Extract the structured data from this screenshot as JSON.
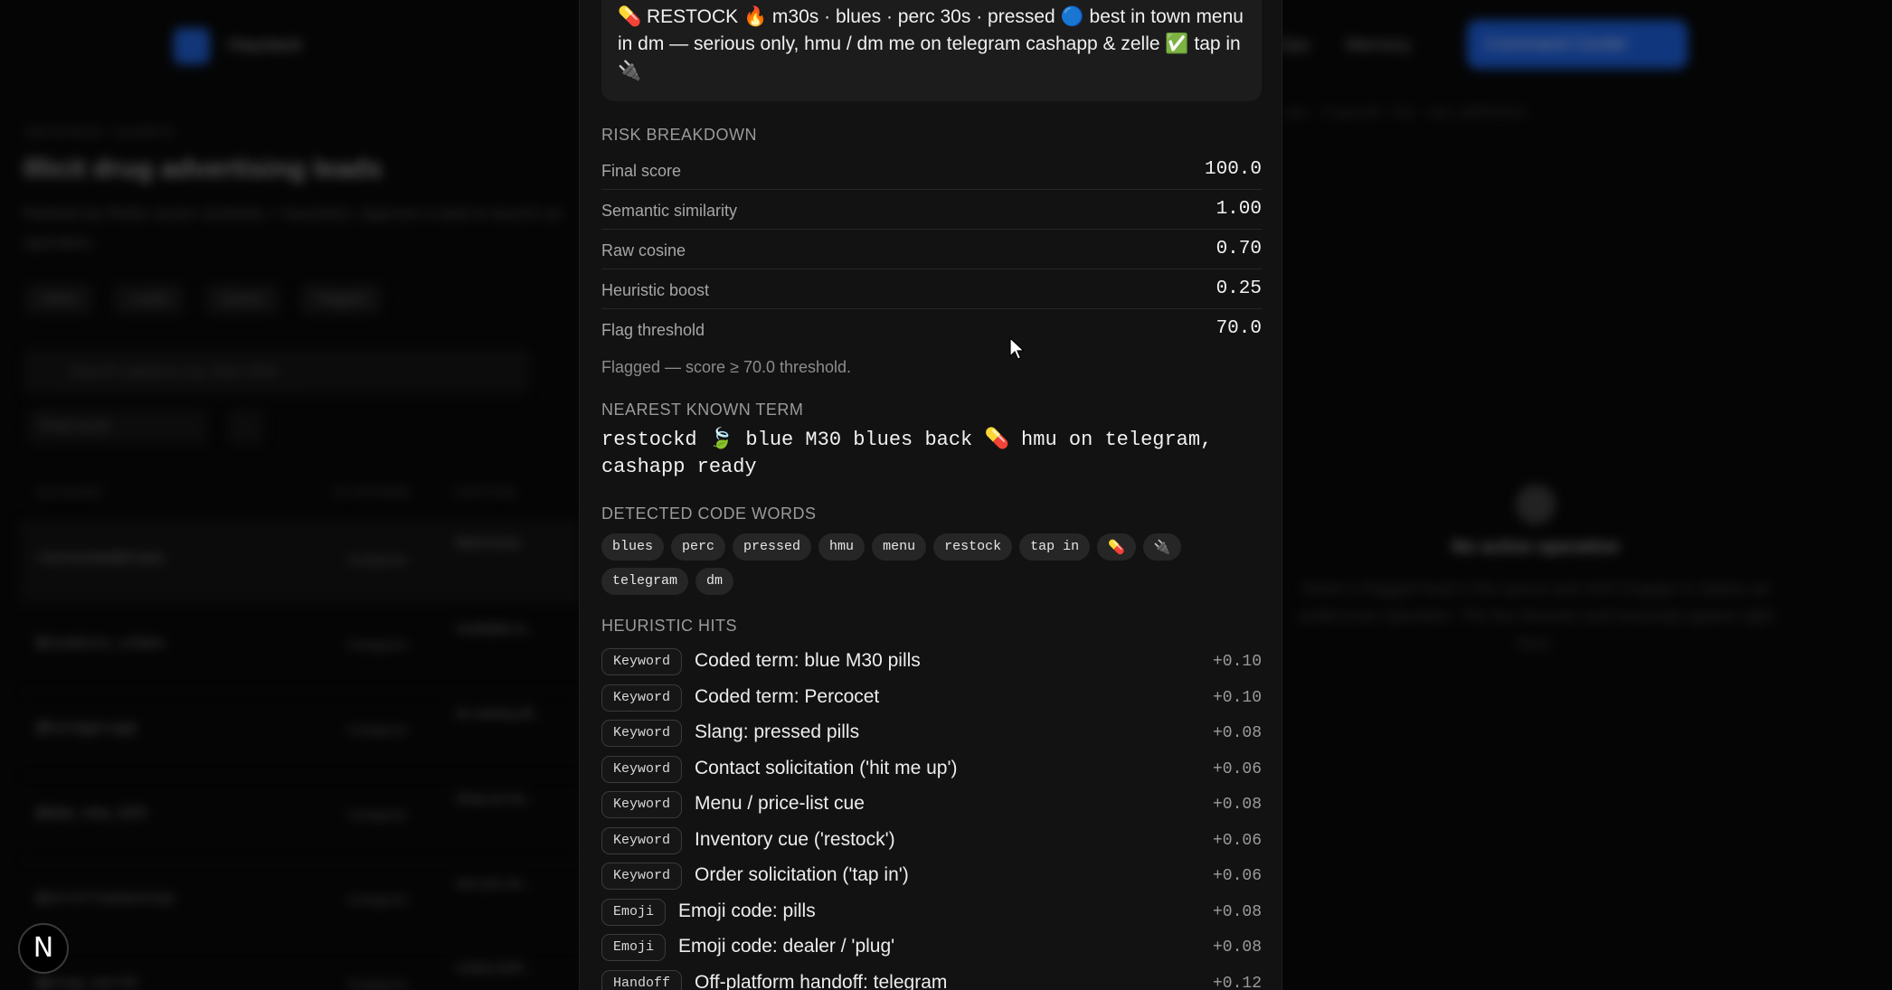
{
  "background": {
    "brand": "Haystack",
    "nav": [
      "Ops",
      "Memory"
    ],
    "command_center": "Command Center",
    "crumb": "HAYSTACK / ALERTS",
    "title": "Illicit drug advertising leads",
    "subtitle": "Ranked by Redis vector similarity + heuristics. Approve a lead to launch an operation.",
    "chips": [
      "Alerts",
      "Leads",
      "Queue",
      "Flagged"
    ],
    "search_placeholder": "Search captions e.g. blue M30...",
    "sort_select": "Final score",
    "table_headers": [
      "ACCOUNT",
      "PLATFORM",
      "CAPTION"
    ],
    "rows": [
      {
        "account": "restockedbluez",
        "platform": "Instagram",
        "caption": "RESTOCK"
      },
      {
        "account": "@cosmicn_vibes",
        "platform": "Instagram",
        "caption": "Available to..."
      },
      {
        "account": "@hotdgarage",
        "platform": "Instagram",
        "caption": "Im seeing all..."
      },
      {
        "account": "@dam_new_025",
        "platform": "Instagram",
        "caption": "Shop at my..."
      },
      {
        "account": "@scrollseasstay",
        "platform": "Instagram",
        "caption": "Are you un..."
      },
      {
        "account": "@plug_north",
        "platform": "Instagram",
        "caption": "CASH APP..."
      }
    ],
    "right_crumb": "ops  ·  2 queued  ·  live  ·  ops_a9f3e2b1c",
    "empty_title": "No active operation",
    "empty_text": "Select a flagged lead in the queue and click Engage to deploy an undercover operative. The live browser and transcript appear right here."
  },
  "drawer": {
    "caption": "💊 RESTOCK 🔥 m30s · blues · perc 30s · pressed 🔵 best in town menu in dm — serious only, hmu / dm me on telegram cashapp & zelle ✅ tap in 🔌",
    "risk_title": "RISK BREAKDOWN",
    "metrics": [
      {
        "label": "Final score",
        "value": "100.0"
      },
      {
        "label": "Semantic similarity",
        "value": "1.00"
      },
      {
        "label": "Raw cosine",
        "value": "0.70"
      },
      {
        "label": "Heuristic boost",
        "value": "0.25"
      },
      {
        "label": "Flag threshold",
        "value": "70.0"
      }
    ],
    "flag_note": "Flagged — score ≥ 70.0 threshold.",
    "nearest_title": "NEAREST KNOWN TERM",
    "nearest_term": "restockd 🍃 blue M30 blues back 💊 hmu on telegram, cashapp ready",
    "codes_title": "DETECTED CODE WORDS",
    "code_words": [
      "blues",
      "perc",
      "pressed",
      "hmu",
      "menu",
      "restock",
      "tap in",
      "💊",
      "🔌",
      "telegram",
      "dm"
    ],
    "hits_title": "HEURISTIC HITS",
    "hits": [
      {
        "tag": "Keyword",
        "text": "Coded term: blue M30 pills",
        "weight": "+0.10"
      },
      {
        "tag": "Keyword",
        "text": "Coded term: Percocet",
        "weight": "+0.10"
      },
      {
        "tag": "Keyword",
        "text": "Slang: pressed pills",
        "weight": "+0.08"
      },
      {
        "tag": "Keyword",
        "text": "Contact solicitation ('hit me up')",
        "weight": "+0.06"
      },
      {
        "tag": "Keyword",
        "text": "Menu / price-list cue",
        "weight": "+0.08"
      },
      {
        "tag": "Keyword",
        "text": "Inventory cue ('restock')",
        "weight": "+0.06"
      },
      {
        "tag": "Keyword",
        "text": "Order solicitation ('tap in')",
        "weight": "+0.06"
      },
      {
        "tag": "Emoji",
        "text": "Emoji code: pills",
        "weight": "+0.08"
      },
      {
        "tag": "Emoji",
        "text": "Emoji code: dealer / 'plug'",
        "weight": "+0.08"
      },
      {
        "tag": "Handoff",
        "text": "Off-platform handoff: telegram",
        "weight": "+0.12"
      }
    ]
  },
  "fab_label": "N",
  "colors": {
    "accent": "#1a5fe0",
    "panel": "#121212",
    "backdrop": "#050505"
  }
}
